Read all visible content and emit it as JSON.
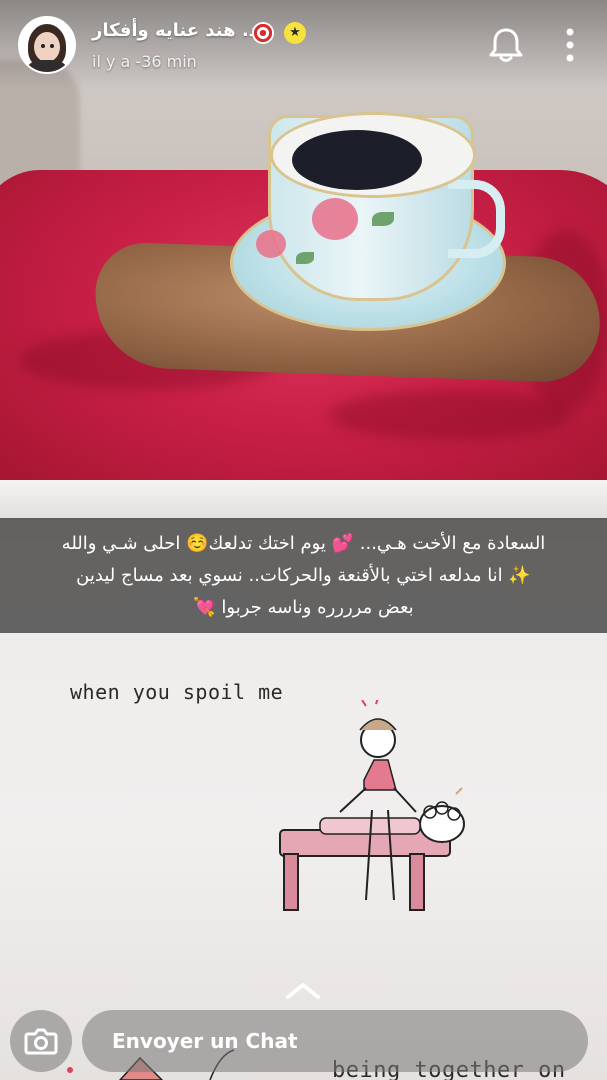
{
  "header": {
    "username": "د. هند عنايه وأفكار",
    "badge_star": "★",
    "timestamp": "il y a -36 min"
  },
  "caption": {
    "lines": [
      "السعادة مع الأخت هـي... 💕 يوم اختك تدلعك☺️ احلى شـي والله",
      "✨ انا مدلعه اختي بالأقنعة والحركات.. نسوي بعد مساج ليدين",
      "بعض مرررره وناسه جربوا 💘"
    ]
  },
  "book": {
    "top_text": "when you spoil me",
    "bottom_text": "being together on"
  },
  "bottom_bar": {
    "chat_placeholder": "Envoyer un Chat"
  },
  "icons": {
    "bell": "bell-icon",
    "more": "more-vertical-icon",
    "camera": "camera-icon",
    "swipe_up": "chevron-up-icon"
  }
}
